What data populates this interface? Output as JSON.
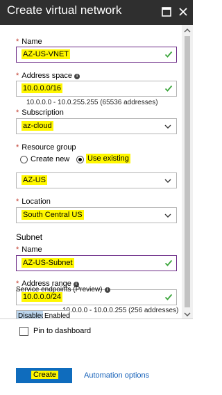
{
  "window": {
    "title": "Create virtual network"
  },
  "fields": {
    "name": {
      "label": "Name",
      "required_mark": "*",
      "value": "AZ-US-VNET"
    },
    "address_space": {
      "label": "Address space",
      "required_mark": "*",
      "value": "10.0.0.0/16",
      "hint": "10.0.0.0 - 10.0.255.255 (65536 addresses)"
    },
    "subscription": {
      "label": "Subscription",
      "required_mark": "*",
      "value": "az-cloud"
    },
    "resource_group": {
      "label": "Resource group",
      "required_mark": "*",
      "options": [
        "Create new",
        "Use existing"
      ],
      "selected": "Use existing",
      "value": "AZ-US"
    },
    "location": {
      "label": "Location",
      "required_mark": "*",
      "value": "South Central US"
    }
  },
  "subnet": {
    "heading": "Subnet",
    "name": {
      "label": "Name",
      "required_mark": "*",
      "value": "AZ-US-Subnet"
    },
    "address_range": {
      "label": "Address range",
      "required_mark": "*",
      "value": "10.0.0.0/24",
      "hint": "10.0.0.0 - 10.0.0.255 (256 addresses)"
    },
    "service_endpoints": {
      "label": "Service endpoints (Preview)",
      "options": [
        "Disabled",
        "Enabled"
      ],
      "selected": "Disabled"
    }
  },
  "footer": {
    "pin_label": "Pin to dashboard",
    "create_label": "Create",
    "automation_label": "Automation options"
  },
  "colors": {
    "titlebar": "#2f2f2f",
    "highlight": "#fff700",
    "primary": "#0f6cbd",
    "link": "#1560b8",
    "check": "#3aa53a",
    "active_border": "#6c2b87"
  }
}
